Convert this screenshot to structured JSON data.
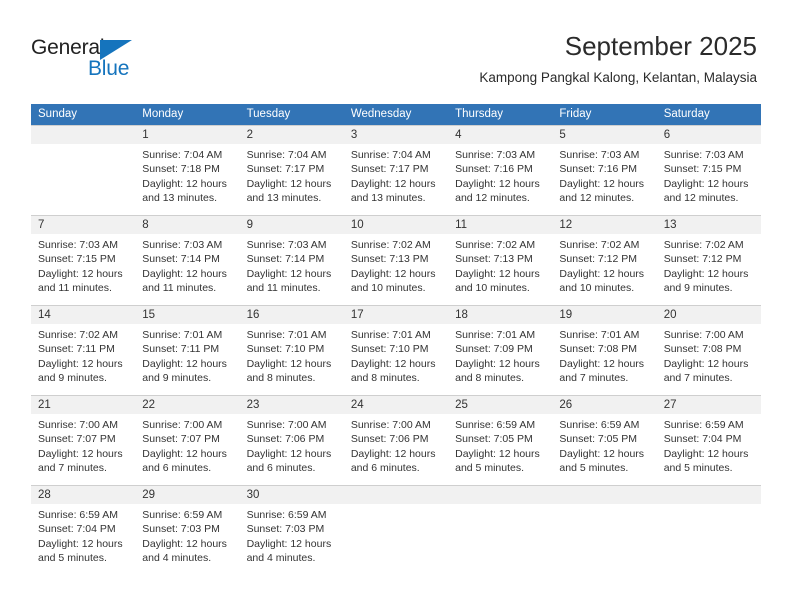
{
  "brand": {
    "name_top": "General",
    "name_bottom": "Blue",
    "accent_color": "#1574bd",
    "triangle_icon": "blue-triangle-icon"
  },
  "header": {
    "title": "September 2025",
    "subtitle": "Kampong Pangkal Kalong, Kelantan, Malaysia",
    "header_bg_color": "#3274b6"
  },
  "calendar": {
    "weekday_headers": [
      "Sunday",
      "Monday",
      "Tuesday",
      "Wednesday",
      "Thursday",
      "Friday",
      "Saturday"
    ],
    "weeks": [
      {
        "days": [
          {
            "num": "",
            "sunrise": "",
            "sunset": "",
            "daylight_line1": "",
            "daylight_line2": ""
          },
          {
            "num": "1",
            "sunrise": "Sunrise: 7:04 AM",
            "sunset": "Sunset: 7:18 PM",
            "daylight_line1": "Daylight: 12 hours",
            "daylight_line2": "and 13 minutes."
          },
          {
            "num": "2",
            "sunrise": "Sunrise: 7:04 AM",
            "sunset": "Sunset: 7:17 PM",
            "daylight_line1": "Daylight: 12 hours",
            "daylight_line2": "and 13 minutes."
          },
          {
            "num": "3",
            "sunrise": "Sunrise: 7:04 AM",
            "sunset": "Sunset: 7:17 PM",
            "daylight_line1": "Daylight: 12 hours",
            "daylight_line2": "and 13 minutes."
          },
          {
            "num": "4",
            "sunrise": "Sunrise: 7:03 AM",
            "sunset": "Sunset: 7:16 PM",
            "daylight_line1": "Daylight: 12 hours",
            "daylight_line2": "and 12 minutes."
          },
          {
            "num": "5",
            "sunrise": "Sunrise: 7:03 AM",
            "sunset": "Sunset: 7:16 PM",
            "daylight_line1": "Daylight: 12 hours",
            "daylight_line2": "and 12 minutes."
          },
          {
            "num": "6",
            "sunrise": "Sunrise: 7:03 AM",
            "sunset": "Sunset: 7:15 PM",
            "daylight_line1": "Daylight: 12 hours",
            "daylight_line2": "and 12 minutes."
          }
        ]
      },
      {
        "days": [
          {
            "num": "7",
            "sunrise": "Sunrise: 7:03 AM",
            "sunset": "Sunset: 7:15 PM",
            "daylight_line1": "Daylight: 12 hours",
            "daylight_line2": "and 11 minutes."
          },
          {
            "num": "8",
            "sunrise": "Sunrise: 7:03 AM",
            "sunset": "Sunset: 7:14 PM",
            "daylight_line1": "Daylight: 12 hours",
            "daylight_line2": "and 11 minutes."
          },
          {
            "num": "9",
            "sunrise": "Sunrise: 7:03 AM",
            "sunset": "Sunset: 7:14 PM",
            "daylight_line1": "Daylight: 12 hours",
            "daylight_line2": "and 11 minutes."
          },
          {
            "num": "10",
            "sunrise": "Sunrise: 7:02 AM",
            "sunset": "Sunset: 7:13 PM",
            "daylight_line1": "Daylight: 12 hours",
            "daylight_line2": "and 10 minutes."
          },
          {
            "num": "11",
            "sunrise": "Sunrise: 7:02 AM",
            "sunset": "Sunset: 7:13 PM",
            "daylight_line1": "Daylight: 12 hours",
            "daylight_line2": "and 10 minutes."
          },
          {
            "num": "12",
            "sunrise": "Sunrise: 7:02 AM",
            "sunset": "Sunset: 7:12 PM",
            "daylight_line1": "Daylight: 12 hours",
            "daylight_line2": "and 10 minutes."
          },
          {
            "num": "13",
            "sunrise": "Sunrise: 7:02 AM",
            "sunset": "Sunset: 7:12 PM",
            "daylight_line1": "Daylight: 12 hours",
            "daylight_line2": "and 9 minutes."
          }
        ]
      },
      {
        "days": [
          {
            "num": "14",
            "sunrise": "Sunrise: 7:02 AM",
            "sunset": "Sunset: 7:11 PM",
            "daylight_line1": "Daylight: 12 hours",
            "daylight_line2": "and 9 minutes."
          },
          {
            "num": "15",
            "sunrise": "Sunrise: 7:01 AM",
            "sunset": "Sunset: 7:11 PM",
            "daylight_line1": "Daylight: 12 hours",
            "daylight_line2": "and 9 minutes."
          },
          {
            "num": "16",
            "sunrise": "Sunrise: 7:01 AM",
            "sunset": "Sunset: 7:10 PM",
            "daylight_line1": "Daylight: 12 hours",
            "daylight_line2": "and 8 minutes."
          },
          {
            "num": "17",
            "sunrise": "Sunrise: 7:01 AM",
            "sunset": "Sunset: 7:10 PM",
            "daylight_line1": "Daylight: 12 hours",
            "daylight_line2": "and 8 minutes."
          },
          {
            "num": "18",
            "sunrise": "Sunrise: 7:01 AM",
            "sunset": "Sunset: 7:09 PM",
            "daylight_line1": "Daylight: 12 hours",
            "daylight_line2": "and 8 minutes."
          },
          {
            "num": "19",
            "sunrise": "Sunrise: 7:01 AM",
            "sunset": "Sunset: 7:08 PM",
            "daylight_line1": "Daylight: 12 hours",
            "daylight_line2": "and 7 minutes."
          },
          {
            "num": "20",
            "sunrise": "Sunrise: 7:00 AM",
            "sunset": "Sunset: 7:08 PM",
            "daylight_line1": "Daylight: 12 hours",
            "daylight_line2": "and 7 minutes."
          }
        ]
      },
      {
        "days": [
          {
            "num": "21",
            "sunrise": "Sunrise: 7:00 AM",
            "sunset": "Sunset: 7:07 PM",
            "daylight_line1": "Daylight: 12 hours",
            "daylight_line2": "and 7 minutes."
          },
          {
            "num": "22",
            "sunrise": "Sunrise: 7:00 AM",
            "sunset": "Sunset: 7:07 PM",
            "daylight_line1": "Daylight: 12 hours",
            "daylight_line2": "and 6 minutes."
          },
          {
            "num": "23",
            "sunrise": "Sunrise: 7:00 AM",
            "sunset": "Sunset: 7:06 PM",
            "daylight_line1": "Daylight: 12 hours",
            "daylight_line2": "and 6 minutes."
          },
          {
            "num": "24",
            "sunrise": "Sunrise: 7:00 AM",
            "sunset": "Sunset: 7:06 PM",
            "daylight_line1": "Daylight: 12 hours",
            "daylight_line2": "and 6 minutes."
          },
          {
            "num": "25",
            "sunrise": "Sunrise: 6:59 AM",
            "sunset": "Sunset: 7:05 PM",
            "daylight_line1": "Daylight: 12 hours",
            "daylight_line2": "and 5 minutes."
          },
          {
            "num": "26",
            "sunrise": "Sunrise: 6:59 AM",
            "sunset": "Sunset: 7:05 PM",
            "daylight_line1": "Daylight: 12 hours",
            "daylight_line2": "and 5 minutes."
          },
          {
            "num": "27",
            "sunrise": "Sunrise: 6:59 AM",
            "sunset": "Sunset: 7:04 PM",
            "daylight_line1": "Daylight: 12 hours",
            "daylight_line2": "and 5 minutes."
          }
        ]
      },
      {
        "days": [
          {
            "num": "28",
            "sunrise": "Sunrise: 6:59 AM",
            "sunset": "Sunset: 7:04 PM",
            "daylight_line1": "Daylight: 12 hours",
            "daylight_line2": "and 5 minutes."
          },
          {
            "num": "29",
            "sunrise": "Sunrise: 6:59 AM",
            "sunset": "Sunset: 7:03 PM",
            "daylight_line1": "Daylight: 12 hours",
            "daylight_line2": "and 4 minutes."
          },
          {
            "num": "30",
            "sunrise": "Sunrise: 6:59 AM",
            "sunset": "Sunset: 7:03 PM",
            "daylight_line1": "Daylight: 12 hours",
            "daylight_line2": "and 4 minutes."
          },
          {
            "num": "",
            "sunrise": "",
            "sunset": "",
            "daylight_line1": "",
            "daylight_line2": ""
          },
          {
            "num": "",
            "sunrise": "",
            "sunset": "",
            "daylight_line1": "",
            "daylight_line2": ""
          },
          {
            "num": "",
            "sunrise": "",
            "sunset": "",
            "daylight_line1": "",
            "daylight_line2": ""
          },
          {
            "num": "",
            "sunrise": "",
            "sunset": "",
            "daylight_line1": "",
            "daylight_line2": ""
          }
        ]
      }
    ]
  }
}
